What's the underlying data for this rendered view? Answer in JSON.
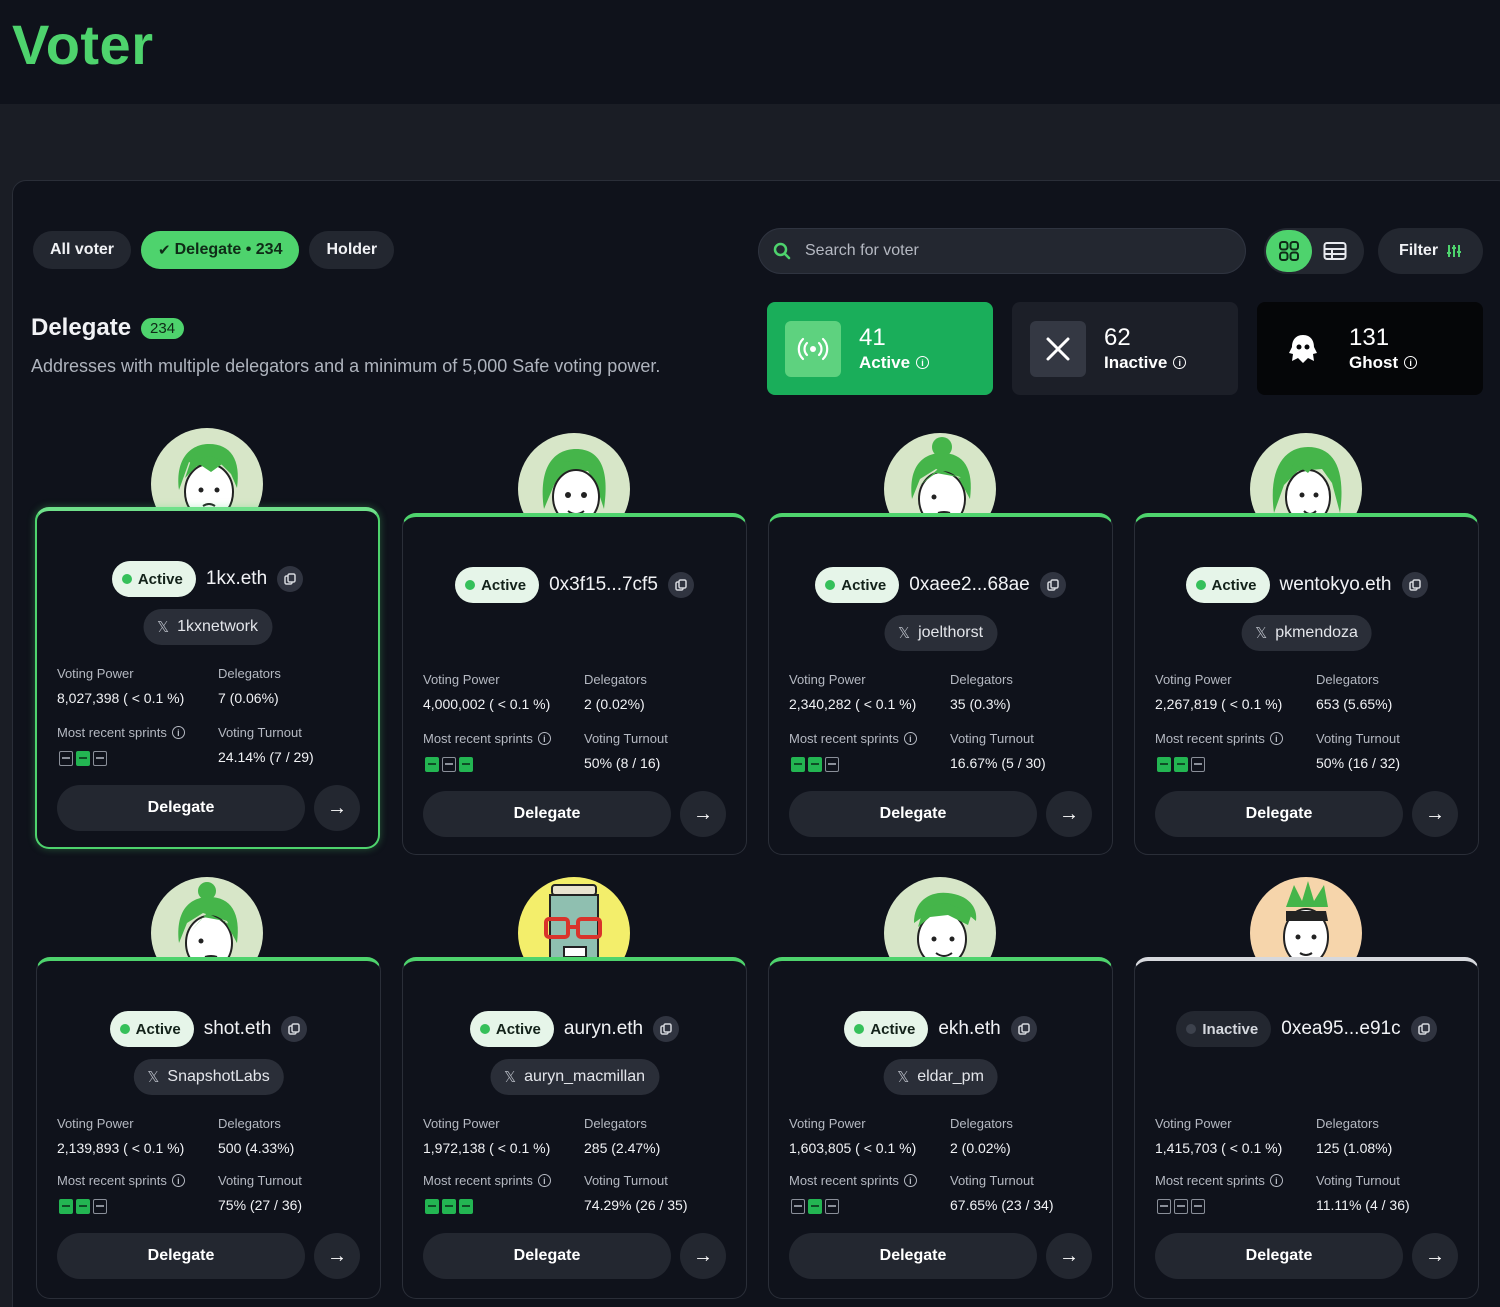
{
  "page": {
    "title": "Voter"
  },
  "tabs": [
    {
      "label": "All voter"
    },
    {
      "label": "Delegate • 234",
      "check": "✔"
    },
    {
      "label": "Holder"
    }
  ],
  "search": {
    "placeholder": "Search for voter"
  },
  "filter": {
    "label": "Filter"
  },
  "section": {
    "title": "Delegate",
    "count": "234",
    "description": "Addresses with multiple delegators and a minimum of 5,000 Safe voting power."
  },
  "stats": {
    "active": {
      "count": "41",
      "label": "Active"
    },
    "inactive": {
      "count": "62",
      "label": "Inactive"
    },
    "ghost": {
      "count": "131",
      "label": "Ghost"
    }
  },
  "labels": {
    "voting_power": "Voting Power",
    "delegators": "Delegators",
    "recent_sprints": "Most recent sprints",
    "voting_turnout": "Voting Turnout",
    "delegate": "Delegate",
    "arrow": "→"
  },
  "colors": {
    "accent": "#4ed36d",
    "active_stat": "#1aae5a",
    "background": "#0f121b"
  },
  "cards": [
    {
      "status": "Active",
      "address": "1kx.eth",
      "social": "1kxnetwork",
      "voting_power": "8,027,398 ( < 0.1 %)",
      "delegators": "7 (0.06%)",
      "turnout": "24.14% (7 / 29)",
      "sprints": [
        false,
        true,
        false
      ]
    },
    {
      "status": "Active",
      "address": "0x3f15...7cf5",
      "social": "",
      "voting_power": "4,000,002 ( < 0.1 %)",
      "delegators": "2 (0.02%)",
      "turnout": "50% (8 / 16)",
      "sprints": [
        true,
        false,
        true
      ]
    },
    {
      "status": "Active",
      "address": "0xaee2...68ae",
      "social": "joelthorst",
      "voting_power": "2,340,282 ( < 0.1 %)",
      "delegators": "35 (0.3%)",
      "turnout": "16.67% (5 / 30)",
      "sprints": [
        true,
        true,
        false
      ]
    },
    {
      "status": "Active",
      "address": "wentokyo.eth",
      "social": "pkmendoza",
      "voting_power": "2,267,819 ( < 0.1 %)",
      "delegators": "653 (5.65%)",
      "turnout": "50% (16 / 32)",
      "sprints": [
        true,
        true,
        false
      ]
    },
    {
      "status": "Active",
      "address": "shot.eth",
      "social": "SnapshotLabs",
      "voting_power": "2,139,893 ( < 0.1 %)",
      "delegators": "500 (4.33%)",
      "turnout": "75% (27 / 36)",
      "sprints": [
        true,
        true,
        false
      ]
    },
    {
      "status": "Active",
      "address": "auryn.eth",
      "social": "auryn_macmillan",
      "voting_power": "1,972,138 ( < 0.1 %)",
      "delegators": "285 (2.47%)",
      "turnout": "74.29% (26 / 35)",
      "sprints": [
        true,
        true,
        true
      ]
    },
    {
      "status": "Active",
      "address": "ekh.eth",
      "social": "eldar_pm",
      "voting_power": "1,603,805 ( < 0.1 %)",
      "delegators": "2 (0.02%)",
      "turnout": "67.65% (23 / 34)",
      "sprints": [
        false,
        true,
        false
      ]
    },
    {
      "status": "Inactive",
      "address": "0xea95...e91c",
      "social": "",
      "voting_power": "1,415,703 ( < 0.1 %)",
      "delegators": "125 (1.08%)",
      "turnout": "11.11% (4 / 36)",
      "sprints": [
        false,
        false,
        false
      ]
    }
  ]
}
